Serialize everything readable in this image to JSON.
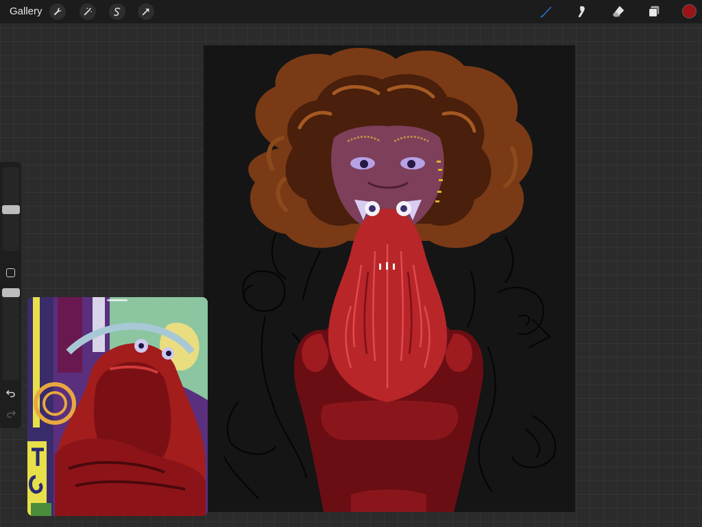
{
  "topbar": {
    "gallery_label": "Gallery",
    "action_icons": [
      "wrench-icon",
      "magic-wand-icon",
      "selection-s-icon",
      "transform-arrow-icon"
    ],
    "tools": [
      "brush-icon",
      "smudge-icon",
      "eraser-icon",
      "layers-icon"
    ],
    "active_tool": "brush",
    "active_tool_color": "#2f7bf5",
    "current_color": "#9a1416"
  },
  "sidebar": {
    "brush_size_level": 0.5,
    "opacity_level": 1.0
  },
  "reference_window": {
    "visible": true
  }
}
